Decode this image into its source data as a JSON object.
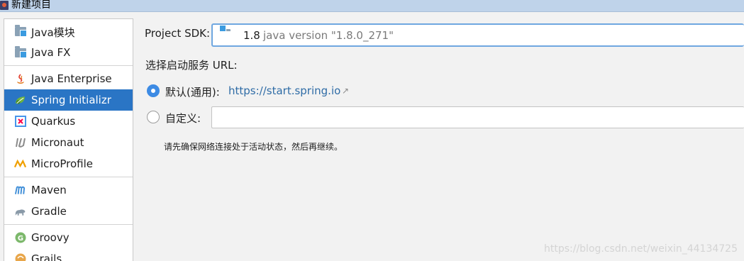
{
  "window": {
    "title": "新建项目"
  },
  "sidebar": {
    "items": [
      {
        "label": "Java模块",
        "icon": "folder-module-icon",
        "selected": false
      },
      {
        "label": "Java FX",
        "icon": "folder-module-icon",
        "selected": false
      },
      {
        "label": "Java Enterprise",
        "icon": "java-cup-icon",
        "selected": false
      },
      {
        "label": "Spring Initializr",
        "icon": "spring-leaf-icon",
        "selected": true
      },
      {
        "label": "Quarkus",
        "icon": "quarkus-icon",
        "selected": false
      },
      {
        "label": "Micronaut",
        "icon": "micronaut-icon",
        "selected": false
      },
      {
        "label": "MicroProfile",
        "icon": "microprofile-icon",
        "selected": false
      },
      {
        "label": "Maven",
        "icon": "maven-icon",
        "selected": false
      },
      {
        "label": "Gradle",
        "icon": "gradle-elephant-icon",
        "selected": false
      },
      {
        "label": "Groovy",
        "icon": "groovy-icon",
        "selected": false
      },
      {
        "label": "Grails",
        "icon": "grails-icon",
        "selected": false
      }
    ]
  },
  "sdk": {
    "label": "Project SDK:",
    "version": "1.8",
    "detail": "java version \"1.8.0_271\""
  },
  "service_url": {
    "label": "选择启动服务 URL:",
    "default_option": {
      "label": "默认(通用):",
      "url": "https://start.spring.io",
      "checked": true
    },
    "custom_option": {
      "label": "自定义:",
      "value": "",
      "checked": false
    }
  },
  "hint": "请先确保网络连接处于活动状态，然后再继续。",
  "watermark": "https://blog.csdn.net/weixin_44134725",
  "colors": {
    "selected_bg": "#2a75c5",
    "link": "#2f6ca6",
    "radio": "#3d8be4"
  }
}
